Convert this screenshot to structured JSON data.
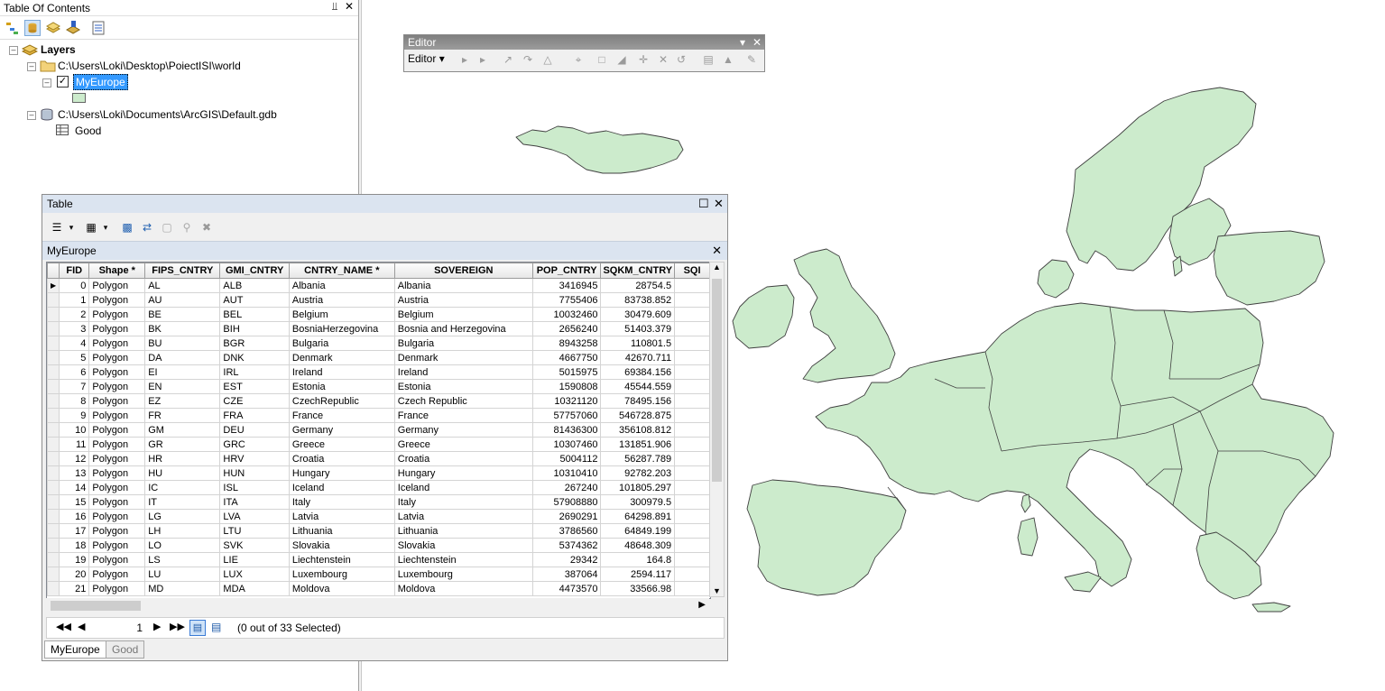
{
  "toc": {
    "title": "Table Of Contents",
    "tree": {
      "root_label": "Layers",
      "folder_path": "C:\\Users\\Loki\\Desktop\\PoiectISI\\world",
      "layer_name": "MyEurope",
      "gdb_path": "C:\\Users\\Loki\\Documents\\ArcGIS\\Default.gdb",
      "table_name": "Good"
    },
    "colors": {
      "fill": "#ccebcc"
    }
  },
  "editor": {
    "title": "Editor",
    "menu_label": "Editor"
  },
  "table_window": {
    "title": "Table",
    "active_table": "MyEurope",
    "columns": [
      "FID",
      "Shape *",
      "FIPS_CNTRY",
      "GMI_CNTRY",
      "CNTRY_NAME *",
      "SOVEREIGN",
      "POP_CNTRY",
      "SQKM_CNTRY",
      "SQI"
    ],
    "rows": [
      [
        "0",
        "Polygon",
        "AL",
        "ALB",
        "Albania",
        "Albania",
        "3416945",
        "28754.5"
      ],
      [
        "1",
        "Polygon",
        "AU",
        "AUT",
        "Austria",
        "Austria",
        "7755406",
        "83738.852"
      ],
      [
        "2",
        "Polygon",
        "BE",
        "BEL",
        "Belgium",
        "Belgium",
        "10032460",
        "30479.609"
      ],
      [
        "3",
        "Polygon",
        "BK",
        "BIH",
        "BosniaHerzegovina",
        "Bosnia and Herzegovina",
        "2656240",
        "51403.379"
      ],
      [
        "4",
        "Polygon",
        "BU",
        "BGR",
        "Bulgaria",
        "Bulgaria",
        "8943258",
        "110801.5"
      ],
      [
        "5",
        "Polygon",
        "DA",
        "DNK",
        "Denmark",
        "Denmark",
        "4667750",
        "42670.711"
      ],
      [
        "6",
        "Polygon",
        "EI",
        "IRL",
        "Ireland",
        "Ireland",
        "5015975",
        "69384.156"
      ],
      [
        "7",
        "Polygon",
        "EN",
        "EST",
        "Estonia",
        "Estonia",
        "1590808",
        "45544.559"
      ],
      [
        "8",
        "Polygon",
        "EZ",
        "CZE",
        "CzechRepublic",
        "Czech Republic",
        "10321120",
        "78495.156"
      ],
      [
        "9",
        "Polygon",
        "FR",
        "FRA",
        "France",
        "France",
        "57757060",
        "546728.875"
      ],
      [
        "10",
        "Polygon",
        "GM",
        "DEU",
        "Germany",
        "Germany",
        "81436300",
        "356108.812"
      ],
      [
        "11",
        "Polygon",
        "GR",
        "GRC",
        "Greece",
        "Greece",
        "10307460",
        "131851.906"
      ],
      [
        "12",
        "Polygon",
        "HR",
        "HRV",
        "Croatia",
        "Croatia",
        "5004112",
        "56287.789"
      ],
      [
        "13",
        "Polygon",
        "HU",
        "HUN",
        "Hungary",
        "Hungary",
        "10310410",
        "92782.203"
      ],
      [
        "14",
        "Polygon",
        "IC",
        "ISL",
        "Iceland",
        "Iceland",
        "267240",
        "101805.297"
      ],
      [
        "15",
        "Polygon",
        "IT",
        "ITA",
        "Italy",
        "Italy",
        "57908880",
        "300979.5"
      ],
      [
        "16",
        "Polygon",
        "LG",
        "LVA",
        "Latvia",
        "Latvia",
        "2690291",
        "64298.891"
      ],
      [
        "17",
        "Polygon",
        "LH",
        "LTU",
        "Lithuania",
        "Lithuania",
        "3786560",
        "64849.199"
      ],
      [
        "18",
        "Polygon",
        "LO",
        "SVK",
        "Slovakia",
        "Slovakia",
        "5374362",
        "48648.309"
      ],
      [
        "19",
        "Polygon",
        "LS",
        "LIE",
        "Liechtenstein",
        "Liechtenstein",
        "29342",
        "164.8"
      ],
      [
        "20",
        "Polygon",
        "LU",
        "LUX",
        "Luxembourg",
        "Luxembourg",
        "387064",
        "2594.117"
      ],
      [
        "21",
        "Polygon",
        "MD",
        "MDA",
        "Moldova",
        "Moldova",
        "4473570",
        "33566.98"
      ]
    ],
    "current_record": "1",
    "selection_status": "(0 out of 33 Selected)",
    "tabs": [
      "MyEurope",
      "Good"
    ]
  }
}
